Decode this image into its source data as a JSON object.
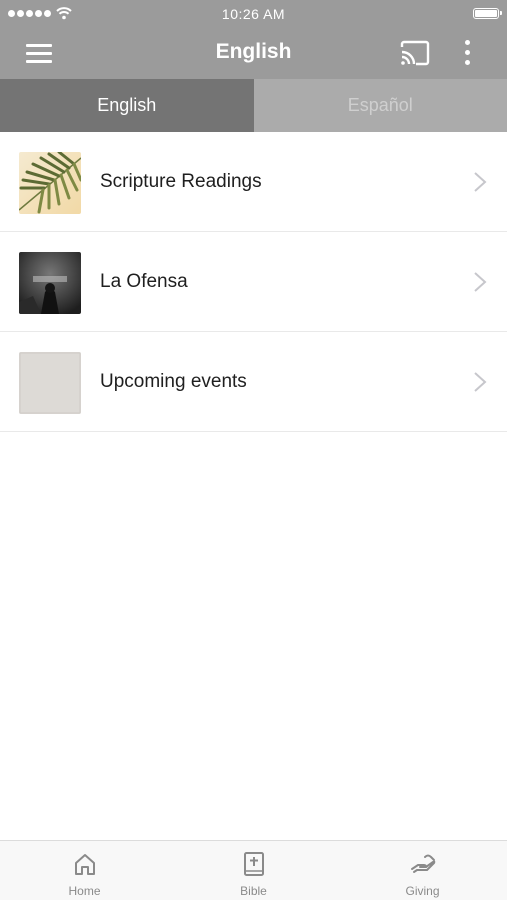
{
  "status_bar": {
    "time": "10:26 AM"
  },
  "app_bar": {
    "title": "English"
  },
  "tabs": [
    {
      "label": "English",
      "active": true
    },
    {
      "label": "Español",
      "active": false
    }
  ],
  "list": {
    "items": [
      {
        "label": "Scripture Readings",
        "thumb": "palm-leaf-image"
      },
      {
        "label": "La Ofensa",
        "thumb": "dark-sermon-image"
      },
      {
        "label": "Upcoming events",
        "thumb": "gray-placeholder-image"
      }
    ]
  },
  "bottom_nav": {
    "items": [
      {
        "label": "Home",
        "icon": "home-icon"
      },
      {
        "label": "Bible",
        "icon": "bible-icon"
      },
      {
        "label": "Giving",
        "icon": "giving-hand-icon"
      }
    ]
  },
  "colors": {
    "bar": "#9b9b9b",
    "tab_active": "#747474",
    "tab_inactive": "#ababab"
  }
}
